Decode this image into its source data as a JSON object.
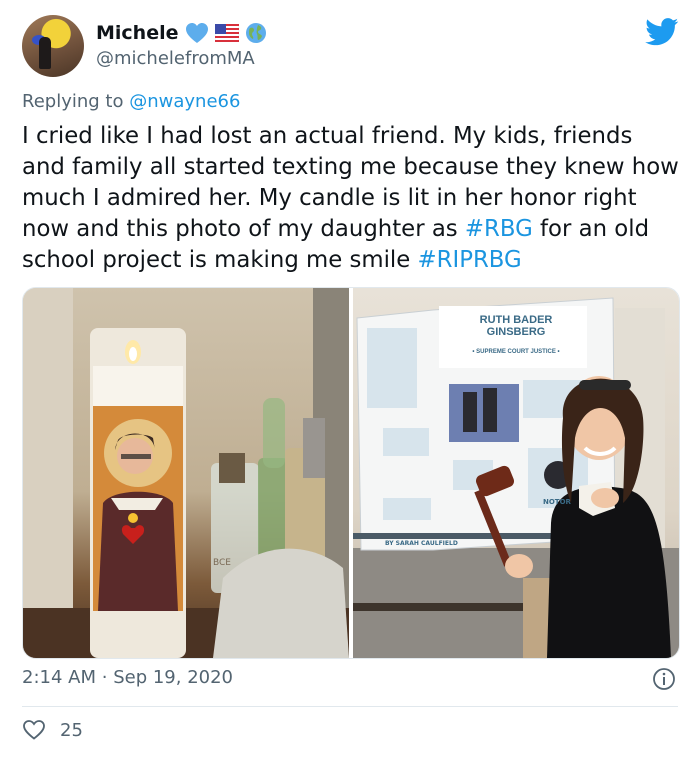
{
  "user": {
    "display_name": "Michele",
    "handle": "@michelefromMA"
  },
  "reply": {
    "prefix": "Replying to",
    "mention": "@nwayne66"
  },
  "tweet": {
    "text_1": "I cried like I had lost an actual friend.  My kids, friends and family all started texting me because they knew how much I admired her.  My candle is lit in her honor right now and this photo of my daughter as ",
    "hashtag_1": "#RBG",
    "text_2": " for an old school project is making me smile ",
    "hashtag_2": "#RIPRBG"
  },
  "poster": {
    "title_line_1": "RUTH BADER",
    "title_line_2": "GINSBERG",
    "subtitle": "• SUPREME COURT JUSTICE •",
    "author": "BY SARAH CAULFIELD",
    "notorious": "NOTOR",
    "candle_label": "BCE"
  },
  "meta": {
    "time": "2:14 AM",
    "separator": "·",
    "date": "Sep 19, 2020"
  },
  "engagement": {
    "likes": "25"
  },
  "colors": {
    "accent": "#1b95e0",
    "text": "#0f1419",
    "muted": "#536471"
  },
  "icons": [
    "blue-heart-icon",
    "us-flag-icon",
    "globe-icon",
    "twitter-bird-icon",
    "info-icon",
    "heart-outline-icon"
  ]
}
